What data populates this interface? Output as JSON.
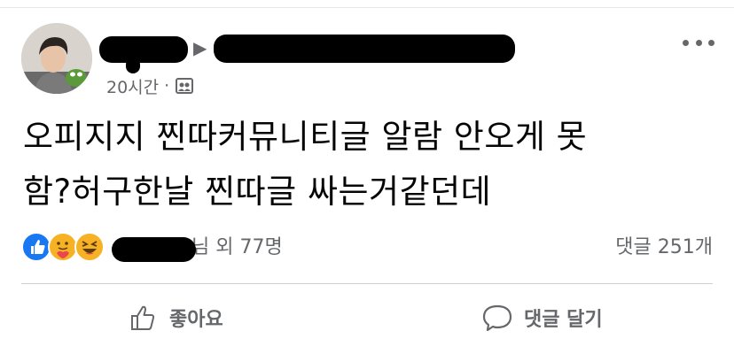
{
  "post": {
    "author_name": "",
    "page_name": "",
    "timestamp": "20시간",
    "separator": "·",
    "audience_icon": "group-icon",
    "more_icon": "more-options-icon",
    "text_lines": [
      "오피지지 찐따커뮤니티글 알람 안오게 못",
      "함?허구한날 찐따글 싸는거같던데"
    ]
  },
  "reactions": {
    "icons": [
      "like-icon",
      "care-icon",
      "haha-icon"
    ],
    "reactors_suffix": "님 외 77명",
    "comments": "댓글 251개"
  },
  "actions": {
    "like_label": "좋아요",
    "comment_label": "댓글 달기"
  },
  "colors": {
    "like_blue": "#1877f2",
    "emoji_yellow": "#f7b125",
    "meta_gray": "#65676b",
    "divider": "#ced0d4"
  }
}
